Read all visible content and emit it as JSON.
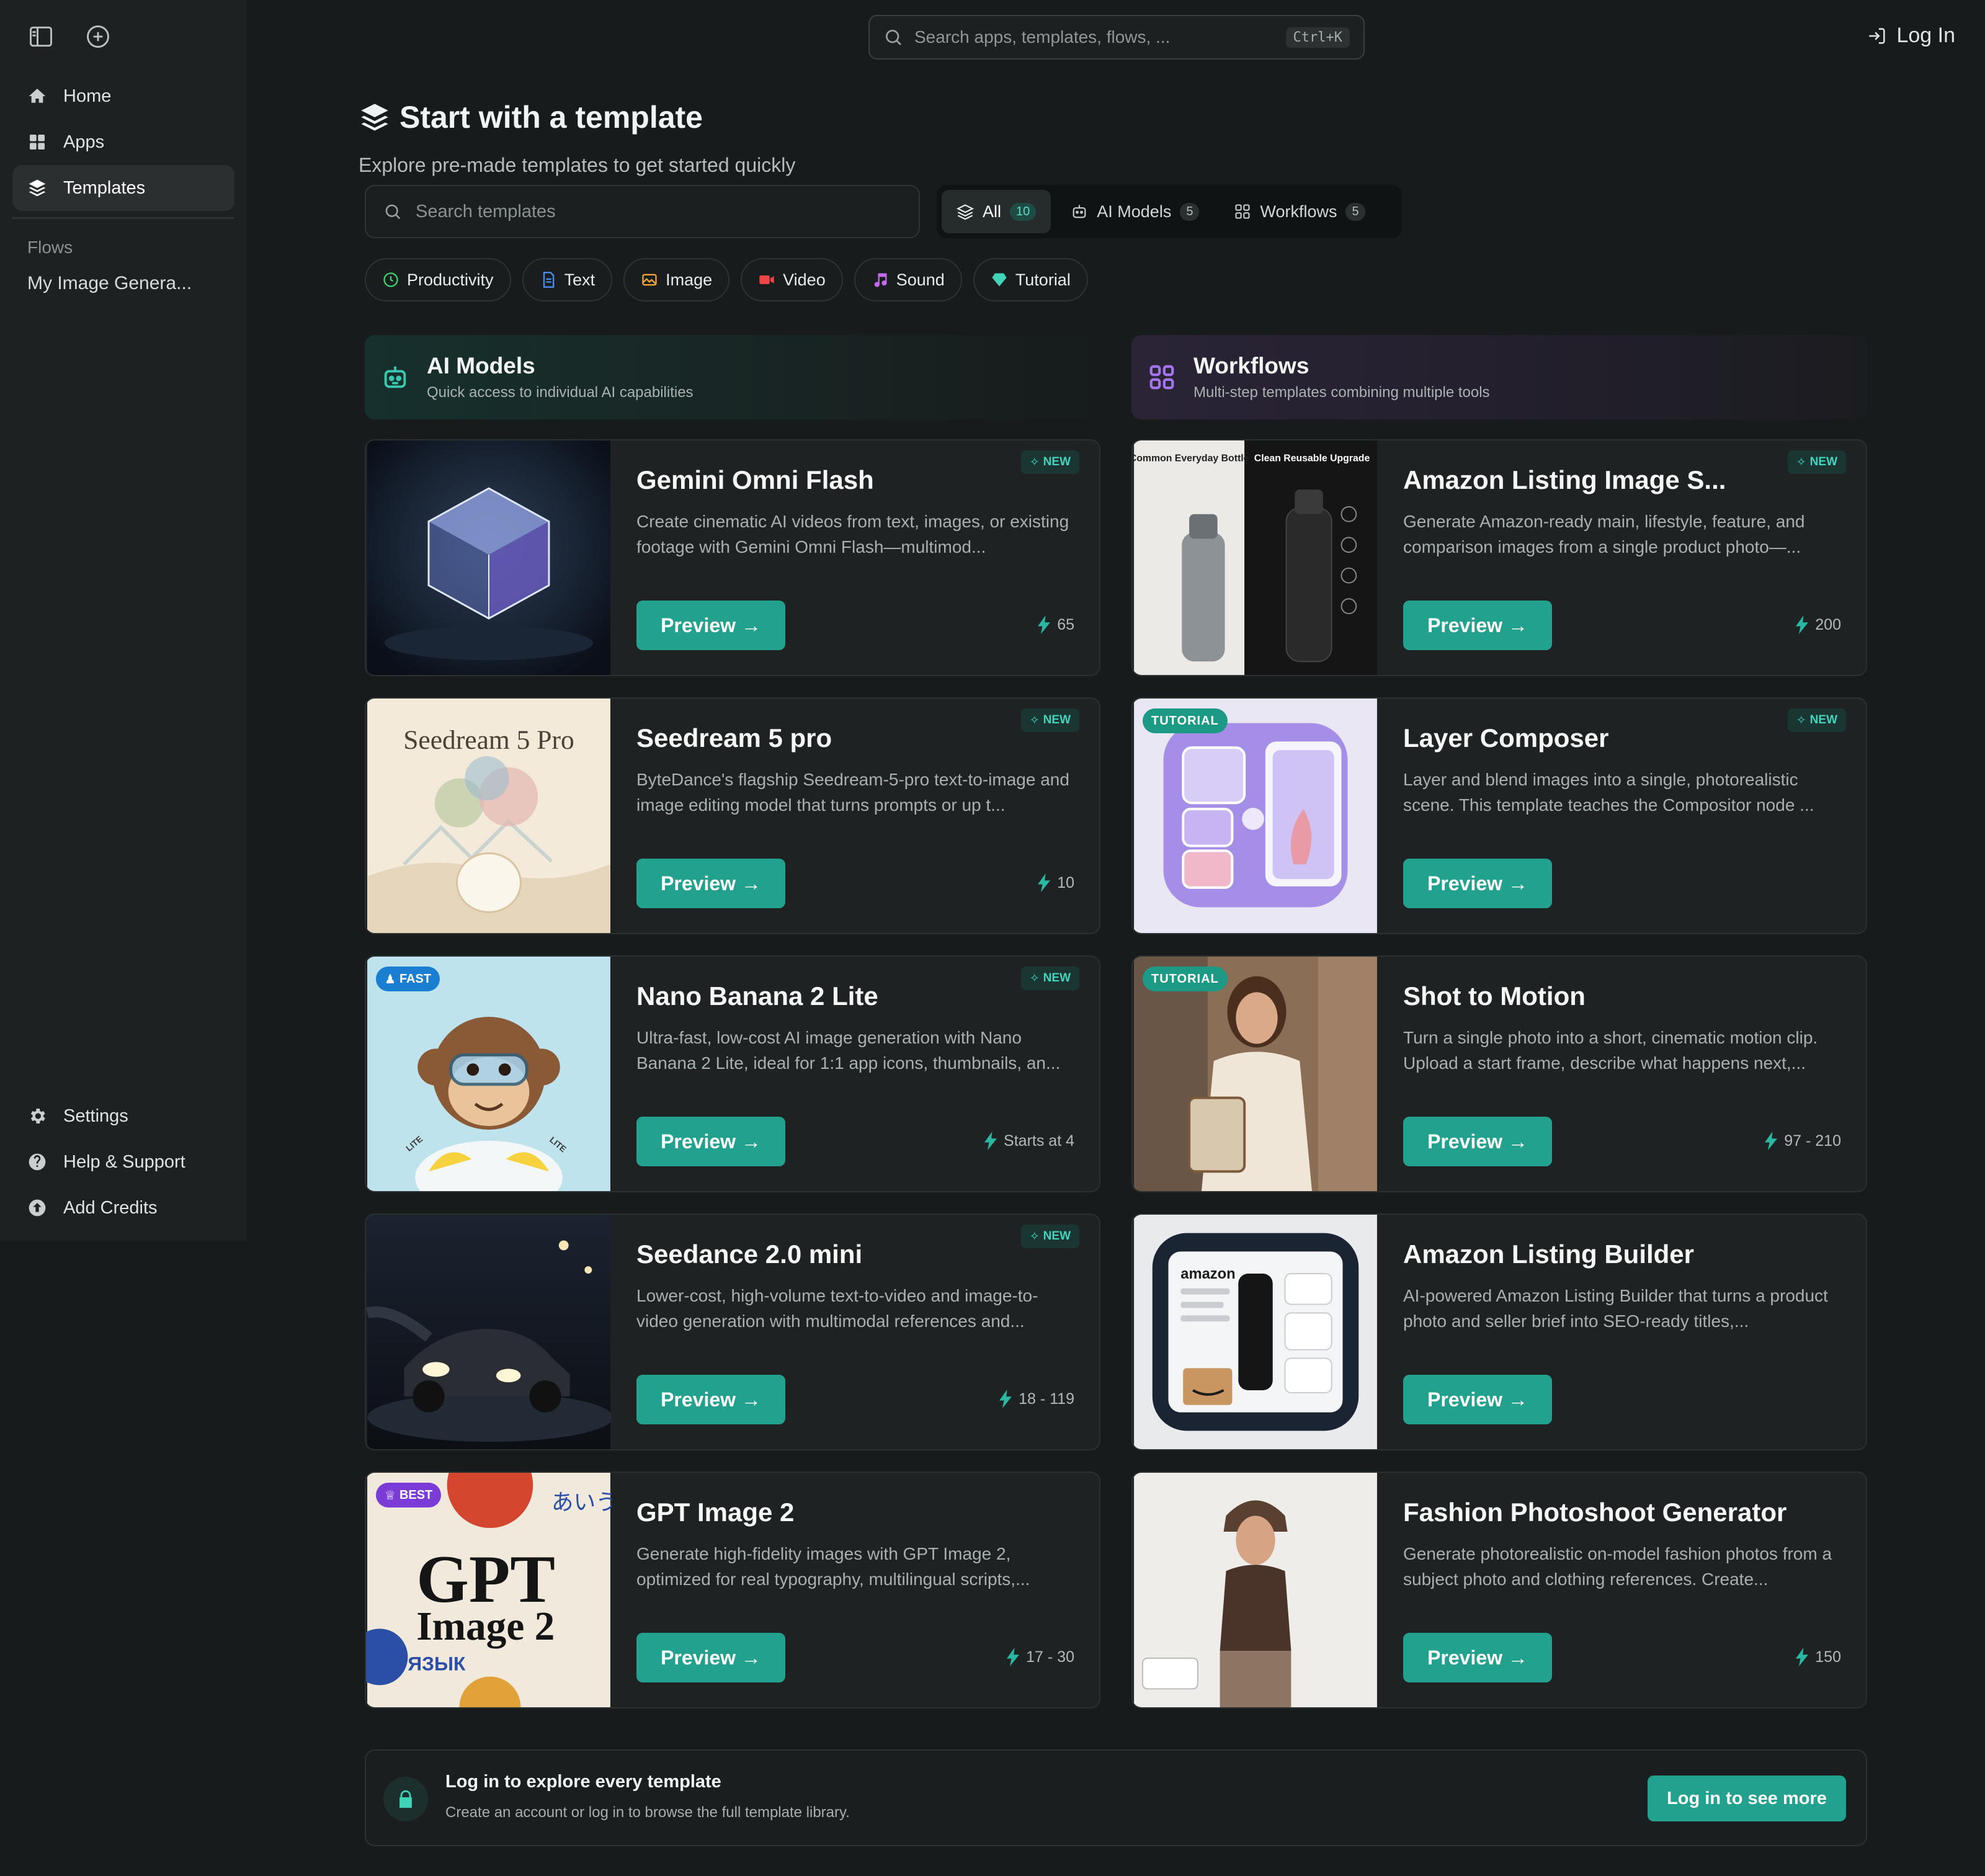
{
  "sidebar": {
    "nav": [
      {
        "label": "Home",
        "icon": "home-icon"
      },
      {
        "label": "Apps",
        "icon": "apps-icon"
      },
      {
        "label": "Templates",
        "icon": "layers-icon",
        "active": true
      }
    ],
    "flows_heading": "Flows",
    "flows": [
      "My Image Genera..."
    ],
    "bottom": [
      {
        "label": "Settings",
        "icon": "gear-icon"
      },
      {
        "label": "Help & Support",
        "icon": "help-icon"
      },
      {
        "label": "Add Credits",
        "icon": "add-credits-icon"
      }
    ]
  },
  "topbar": {
    "search_placeholder": "Search apps, templates, flows, ...",
    "shortcut": "Ctrl+K",
    "login_label": "Log In"
  },
  "header": {
    "title": "Start with a template",
    "subtitle": "Explore pre-made templates to get started quickly"
  },
  "template_search": {
    "placeholder": "Search templates"
  },
  "filter_tabs": [
    {
      "label": "All",
      "count": "10",
      "active": true
    },
    {
      "label": "AI Models",
      "count": "5"
    },
    {
      "label": "Workflows",
      "count": "5"
    }
  ],
  "chips": [
    {
      "label": "Productivity",
      "color": "#3ecf6e"
    },
    {
      "label": "Text",
      "color": "#4a8ff0"
    },
    {
      "label": "Image",
      "color": "#f0a23a"
    },
    {
      "label": "Video",
      "color": "#ee4646"
    },
    {
      "label": "Sound",
      "color": "#c56af0"
    },
    {
      "label": "Tutorial",
      "color": "#3fd3b7"
    }
  ],
  "sections": {
    "models": {
      "title": "AI Models",
      "subtitle": "Quick access to individual AI capabilities"
    },
    "workflows": {
      "title": "Workflows",
      "subtitle": "Multi-step templates combining multiple tools"
    }
  },
  "badges": {
    "new": "NEW",
    "tutorial": "TUTORIAL",
    "fast": "FAST",
    "best": "BEST"
  },
  "preview_label": "Preview →",
  "models": [
    {
      "title": "Gemini Omni Flash",
      "desc": "Create cinematic AI videos from text, images, or existing footage with Gemini Omni Flash—multimod...",
      "credits": "65"
    },
    {
      "title": "Seedream 5 pro",
      "desc": "ByteDance's flagship Seedream-5-pro text-to-image and image editing model that turns prompts or up t...",
      "credits": "10",
      "thumb_text": "Seedream 5 Pro"
    },
    {
      "title": "Nano Banana 2 Lite",
      "desc": "Ultra-fast, low-cost AI image generation with Nano Banana 2 Lite, ideal for 1:1 app icons, thumbnails, an...",
      "credits": "Starts at 4",
      "thumb_text": "LITE"
    },
    {
      "title": "Seedance 2.0 mini",
      "desc": "Lower-cost, high-volume text-to-video and image-to-video generation with multimodal references and...",
      "credits": "18 - 119"
    },
    {
      "title": "GPT Image 2",
      "desc": "Generate high-fidelity images with GPT Image 2, optimized for real typography, multilingual scripts,...",
      "credits": "17 - 30",
      "thumb_text_1": "GPT",
      "thumb_text_2": "Image 2",
      "thumb_text_3": "ЯЗЫК",
      "thumb_text_4": "あいう"
    }
  ],
  "workflows": [
    {
      "title": "Amazon Listing Image S...",
      "desc": "Generate Amazon-ready main, lifestyle, feature, and comparison images from a single product photo—...",
      "credits": "200",
      "thumb_left": "Common Everyday Bottle",
      "thumb_right": "Clean Reusable Upgrade"
    },
    {
      "title": "Layer Composer",
      "desc": "Layer and blend images into a single, photorealistic scene. This template teaches the Compositor node ...",
      "credits": ""
    },
    {
      "title": "Shot to Motion",
      "desc": "Turn a single photo into a short, cinematic motion clip. Upload a start frame, describe what happens next,...",
      "credits": "97 - 210"
    },
    {
      "title": "Amazon Listing Builder",
      "desc": "AI-powered Amazon Listing Builder that turns a product photo and seller brief into SEO-ready titles,...",
      "credits": "",
      "thumb_text": "amazon"
    },
    {
      "title": "Fashion Photoshoot Generator",
      "desc": "Generate photorealistic on-model fashion photos from a subject photo and clothing references. Create...",
      "credits": "150"
    }
  ],
  "banner": {
    "title": "Log in to explore every template",
    "subtitle": "Create an account or log in to browse the full template library.",
    "button": "Log in to see more"
  },
  "colors": {
    "accent": "#23a18f",
    "background": "#171b1b",
    "card": "#1e2222"
  }
}
